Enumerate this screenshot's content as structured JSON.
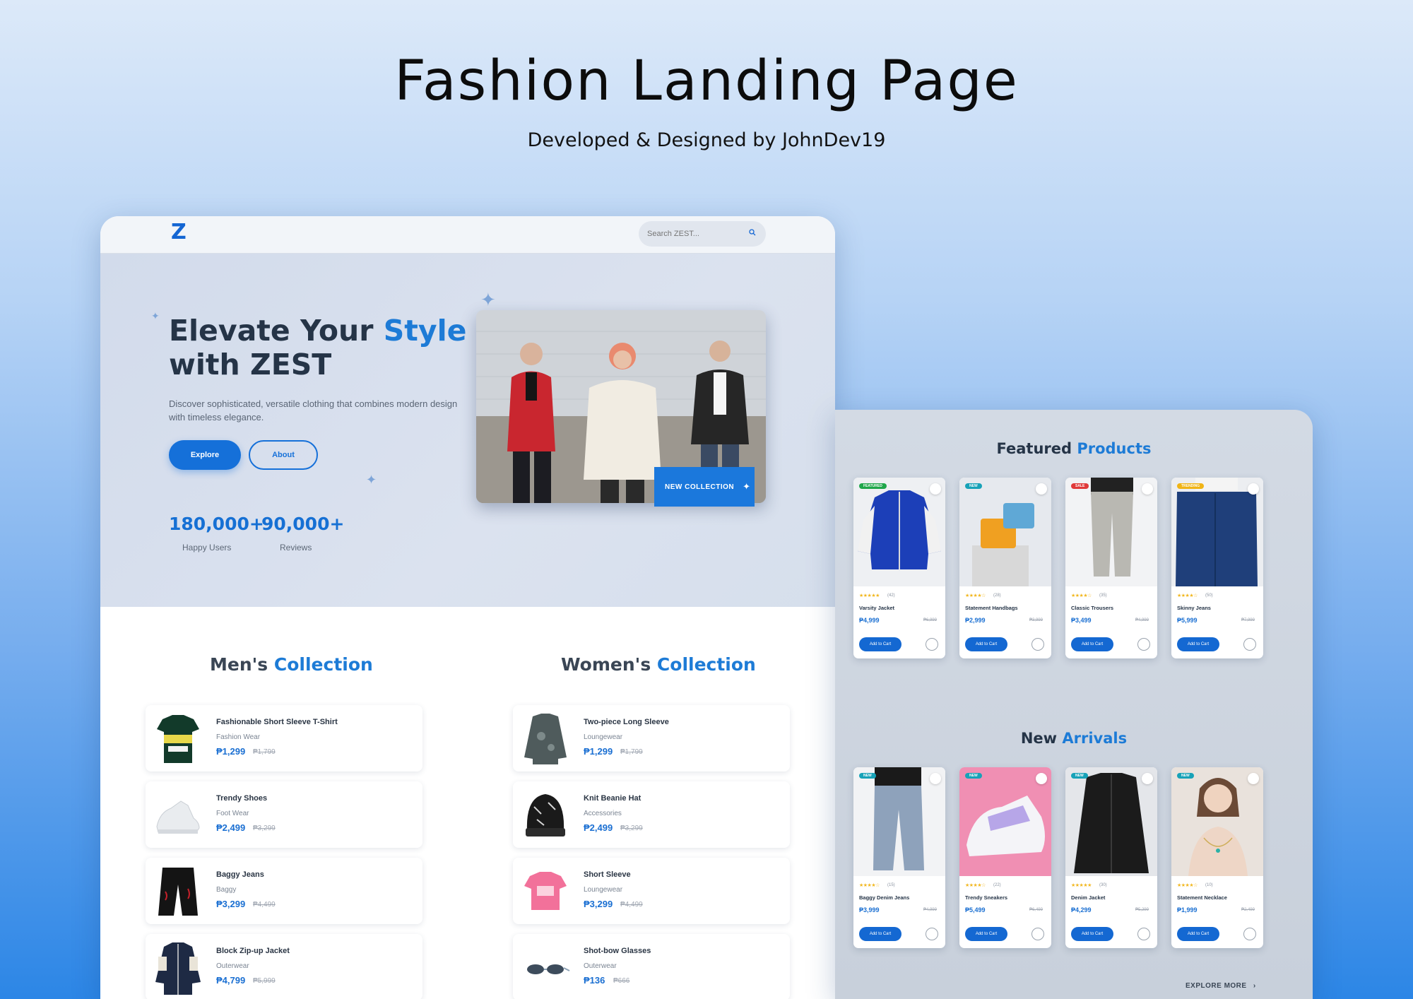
{
  "header": {
    "title": "Fashion Landing Page",
    "subtitle": "Developed & Designed by JohnDev19"
  },
  "site": {
    "logo": "Z",
    "search_placeholder": "Search ZEST..."
  },
  "hero": {
    "title_part1": "Elevate Your ",
    "title_highlight": "Style",
    "title_line2": "with ZEST",
    "description": "Discover sophisticated, versatile clothing that combines modern design with timeless elegance.",
    "explore_label": "Explore",
    "about_label": "About",
    "stats": [
      {
        "value": "180,000+",
        "label": "Happy Users"
      },
      {
        "value": "90,000+",
        "label": "Reviews"
      }
    ],
    "banner_label": "NEW COLLECTION"
  },
  "mens": {
    "title": "Men's",
    "highlight": "Collection",
    "items": [
      {
        "name": "Fashionable Short Sleeve T-Shirt",
        "category": "Fashion Wear",
        "price": "₱1,299",
        "old": "₱1,799"
      },
      {
        "name": "Trendy Shoes",
        "category": "Foot Wear",
        "price": "₱2,499",
        "old": "₱3,299"
      },
      {
        "name": "Baggy Jeans",
        "category": "Baggy",
        "price": "₱3,299",
        "old": "₱4,499"
      },
      {
        "name": "Block Zip-up Jacket",
        "category": "Outerwear",
        "price": "₱4,799",
        "old": "₱5,999"
      }
    ]
  },
  "womens": {
    "title": "Women's",
    "highlight": "Collection",
    "items": [
      {
        "name": "Two-piece Long Sleeve",
        "category": "Loungewear",
        "price": "₱1,299",
        "old": "₱1,799"
      },
      {
        "name": "Knit Beanie Hat",
        "category": "Accessories",
        "price": "₱2,499",
        "old": "₱3,299"
      },
      {
        "name": "Short Sleeve",
        "category": "Loungewear",
        "price": "₱3,299",
        "old": "₱4,499"
      },
      {
        "name": "Shot-bow Glasses",
        "category": "Outerwear",
        "price": "₱136",
        "old": "₱666"
      }
    ]
  },
  "featured": {
    "title": "Featured",
    "highlight": "Products",
    "cards": [
      {
        "badge": "FEATURED",
        "badge_color": "#1fa64a",
        "count": "(42)",
        "name": "Varsity Jacket",
        "price": "₱4,999",
        "old": "₱6,999",
        "stars": "★★★★★"
      },
      {
        "badge": "NEW",
        "badge_color": "#17a2b8",
        "count": "(28)",
        "name": "Statement Handbags",
        "price": "₱2,999",
        "old": "₱3,999",
        "stars": "★★★★☆"
      },
      {
        "badge": "SALE",
        "badge_color": "#e03a3a",
        "count": "(35)",
        "name": "Classic Trousers",
        "price": "₱3,499",
        "old": "₱4,999",
        "stars": "★★★★☆"
      },
      {
        "badge": "TRENDING",
        "badge_color": "#f0b416",
        "count": "(50)",
        "name": "Skinny Jeans",
        "price": "₱5,999",
        "old": "₱7,999",
        "stars": "★★★★☆"
      }
    ]
  },
  "arrivals": {
    "title": "New",
    "highlight": "Arrivals",
    "cards": [
      {
        "badge": "NEW",
        "badge_color": "#17a2b8",
        "count": "(15)",
        "name": "Baggy Denim Jeans",
        "price": "₱3,999",
        "old": "₱4,999",
        "stars": "★★★★☆"
      },
      {
        "badge": "NEW",
        "badge_color": "#17a2b8",
        "count": "(22)",
        "name": "Trendy Sneakers",
        "price": "₱5,499",
        "old": "₱6,499",
        "stars": "★★★★☆"
      },
      {
        "badge": "NEW",
        "badge_color": "#17a2b8",
        "count": "(30)",
        "name": "Denim Jacket",
        "price": "₱4,299",
        "old": "₱5,299",
        "stars": "★★★★★"
      },
      {
        "badge": "NEW",
        "badge_color": "#17a2b8",
        "count": "(10)",
        "name": "Statement Necklace",
        "price": "₱1,999",
        "old": "₱2,499",
        "stars": "★★★★☆"
      }
    ]
  },
  "card_labels": {
    "add_to_cart": "Add to Cart"
  },
  "explore_more": "EXPLORE MORE"
}
